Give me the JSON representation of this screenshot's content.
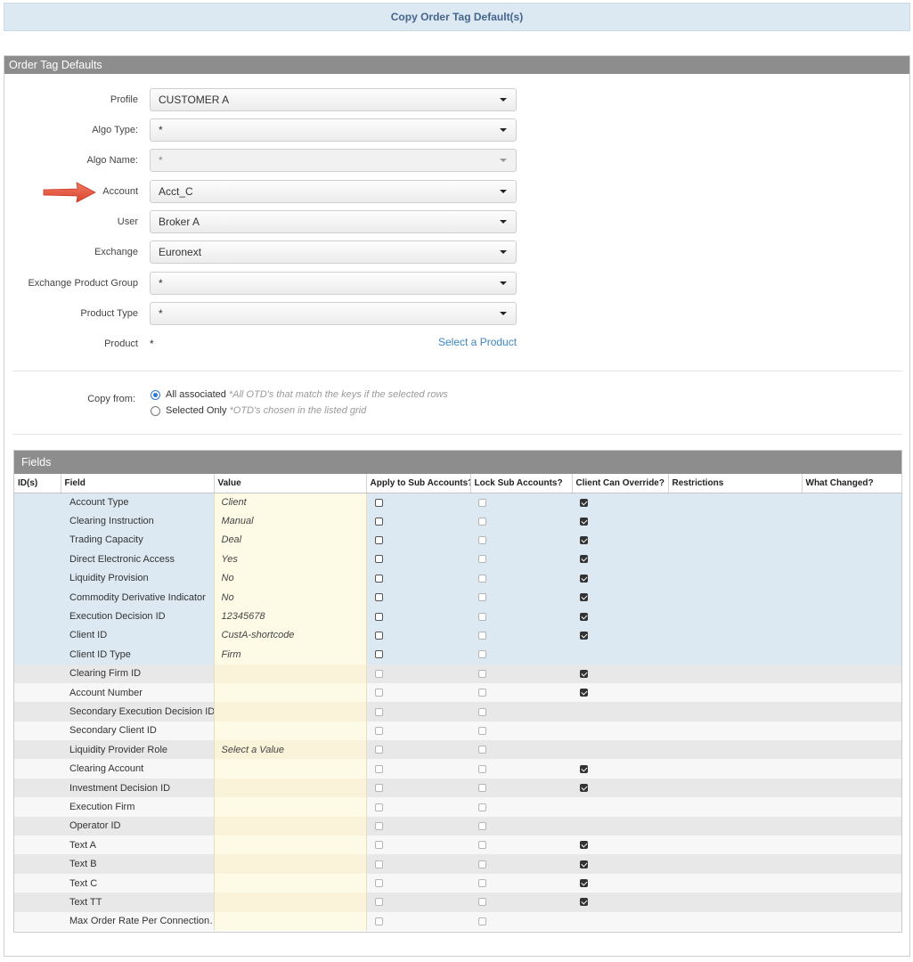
{
  "title": "Copy Order Tag Default(s)",
  "panel_title": "Order Tag Defaults",
  "form": {
    "profile": {
      "label": "Profile",
      "value": "CUSTOMER A"
    },
    "algo_type": {
      "label": "Algo Type:",
      "value": "*"
    },
    "algo_name": {
      "label": "Algo Name:",
      "value": "*"
    },
    "account": {
      "label": "Account",
      "value": "Acct_C"
    },
    "user": {
      "label": "User",
      "value": "Broker A"
    },
    "exchange": {
      "label": "Exchange",
      "value": "Euronext"
    },
    "exchange_product_group": {
      "label": "Exchange Product Group",
      "value": "*"
    },
    "product_type": {
      "label": "Product Type",
      "value": "*"
    },
    "product": {
      "label": "Product",
      "value": "*",
      "link": "Select a Product"
    }
  },
  "copy_from": {
    "label": "Copy from:",
    "options": [
      {
        "label": "All associated",
        "note": "*All OTD's that match the keys if the selected rows",
        "selected": true
      },
      {
        "label": "Selected Only",
        "note": "*OTD's chosen in the listed grid",
        "selected": false
      }
    ]
  },
  "fields_panel": {
    "title": "Fields",
    "columns": [
      "ID(s)",
      "Field",
      "Value",
      "Apply to Sub Accounts?",
      "Lock Sub Accounts?",
      "Client Can Override?",
      "Restrictions",
      "What Changed?"
    ],
    "rows": [
      {
        "field": "Account Type",
        "value": "Client",
        "apply": "enabled",
        "lock": "disabled",
        "override": true,
        "style": "blue"
      },
      {
        "field": "Clearing Instruction",
        "value": "Manual",
        "apply": "enabled",
        "lock": "disabled",
        "override": true,
        "style": "blue"
      },
      {
        "field": "Trading Capacity",
        "value": "Deal",
        "apply": "enabled",
        "lock": "disabled",
        "override": true,
        "style": "blue"
      },
      {
        "field": "Direct Electronic Access",
        "value": "Yes",
        "apply": "enabled",
        "lock": "disabled",
        "override": true,
        "style": "blue"
      },
      {
        "field": "Liquidity Provision",
        "value": "No",
        "apply": "enabled",
        "lock": "disabled",
        "override": true,
        "style": "blue"
      },
      {
        "field": "Commodity Derivative Indicator",
        "value": "No",
        "apply": "enabled",
        "lock": "disabled",
        "override": true,
        "style": "blue"
      },
      {
        "field": "Execution Decision ID",
        "value": "12345678",
        "apply": "enabled",
        "lock": "disabled",
        "override": true,
        "style": "blue"
      },
      {
        "field": "Client ID",
        "value": "CustA-shortcode",
        "apply": "enabled",
        "lock": "disabled",
        "override": true,
        "style": "blue"
      },
      {
        "field": "Client ID Type",
        "value": "Firm",
        "apply": "enabled",
        "lock": "disabled",
        "override": false,
        "style": "blue"
      },
      {
        "field": "Clearing Firm ID",
        "value": "",
        "apply": "disabled",
        "lock": "disabled",
        "override": true,
        "style": "gray"
      },
      {
        "field": "Account Number",
        "value": "",
        "apply": "disabled",
        "lock": "disabled",
        "override": true,
        "style": "white"
      },
      {
        "field": "Secondary Execution Decision ID",
        "value": "",
        "apply": "disabled",
        "lock": "disabled",
        "override": false,
        "style": "gray"
      },
      {
        "field": "Secondary Client ID",
        "value": "",
        "apply": "disabled",
        "lock": "disabled",
        "override": false,
        "style": "white"
      },
      {
        "field": "Liquidity Provider Role",
        "value": "Select a Value",
        "apply": "disabled",
        "lock": "disabled",
        "override": false,
        "style": "gray"
      },
      {
        "field": "Clearing Account",
        "value": "",
        "apply": "disabled",
        "lock": "disabled",
        "override": true,
        "style": "white"
      },
      {
        "field": "Investment Decision ID",
        "value": "",
        "apply": "disabled",
        "lock": "disabled",
        "override": true,
        "style": "gray"
      },
      {
        "field": "Execution Firm",
        "value": "",
        "apply": "disabled",
        "lock": "disabled",
        "override": false,
        "style": "white"
      },
      {
        "field": "Operator ID",
        "value": "",
        "apply": "disabled",
        "lock": "disabled",
        "override": false,
        "style": "gray"
      },
      {
        "field": "Text A",
        "value": "",
        "apply": "disabled",
        "lock": "disabled",
        "override": true,
        "style": "white"
      },
      {
        "field": "Text B",
        "value": "",
        "apply": "disabled",
        "lock": "disabled",
        "override": true,
        "style": "gray"
      },
      {
        "field": "Text C",
        "value": "",
        "apply": "disabled",
        "lock": "disabled",
        "override": true,
        "style": "white"
      },
      {
        "field": "Text TT",
        "value": "",
        "apply": "disabled",
        "lock": "disabled",
        "override": true,
        "style": "gray"
      },
      {
        "field": "Max Order Rate Per Connection…",
        "value": "",
        "apply": "disabled",
        "lock": "disabled",
        "override": false,
        "style": "white"
      }
    ]
  },
  "colors": {
    "accent": "#3b86c2",
    "header_gray": "#8d8d8d",
    "row_blue": "#dde9f2",
    "value_cell": "#fdfbe6",
    "arrow": "#e8533f"
  },
  "icons": {
    "select_caret": "chevron-down-icon",
    "annotation_arrow": "arrow-right-icon"
  }
}
